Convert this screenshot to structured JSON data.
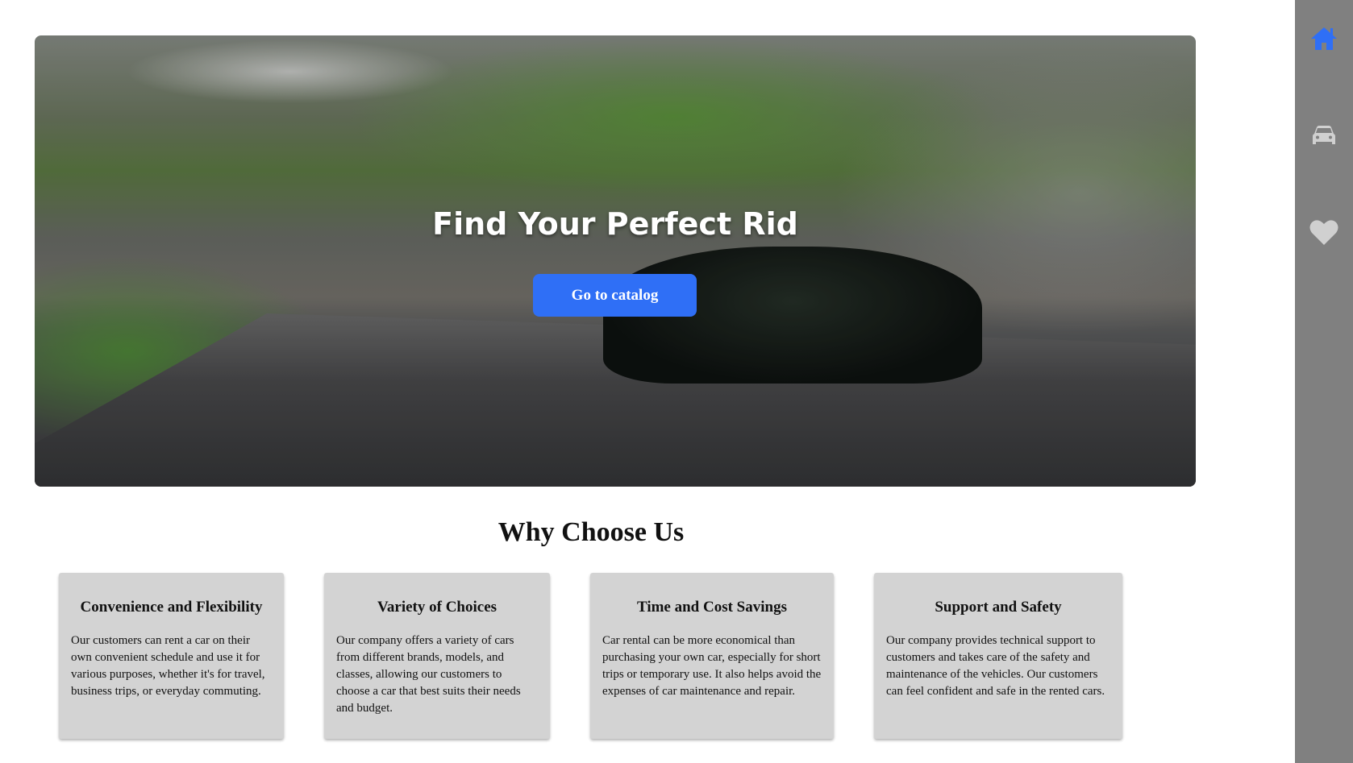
{
  "hero": {
    "title": "Find Your Perfect Rid",
    "cta_label": "Go to catalog"
  },
  "section": {
    "title": "Why Choose Us"
  },
  "cards": [
    {
      "title": "Convenience and Flexibility",
      "text": "Our customers can rent a car on their own convenient schedule and use it for various purposes, whether it's for travel, business trips, or everyday commuting."
    },
    {
      "title": "Variety of Choices",
      "text": "Our company offers a variety of cars from different brands, models, and classes, allowing our customers to choose a car that best suits their needs and budget."
    },
    {
      "title": "Time and Cost Savings",
      "text": "Car rental can be more economical than purchasing your own car, especially for short trips or temporary use. It also helps avoid the expenses of car maintenance and repair."
    },
    {
      "title": "Support and Safety",
      "text": "Our company provides technical support to customers and takes care of the safety and maintenance of the vehicles. Our customers can feel confident and safe in the rented cars."
    }
  ],
  "sidebar": {
    "items": [
      {
        "icon": "home-icon",
        "active": true
      },
      {
        "icon": "car-icon",
        "active": false
      },
      {
        "icon": "heart-icon",
        "active": false
      }
    ]
  },
  "colors": {
    "accent": "#2f6ff6",
    "sidebar": "#808080",
    "card": "#d3d3d3",
    "icon_inactive": "#d0d0d0"
  }
}
